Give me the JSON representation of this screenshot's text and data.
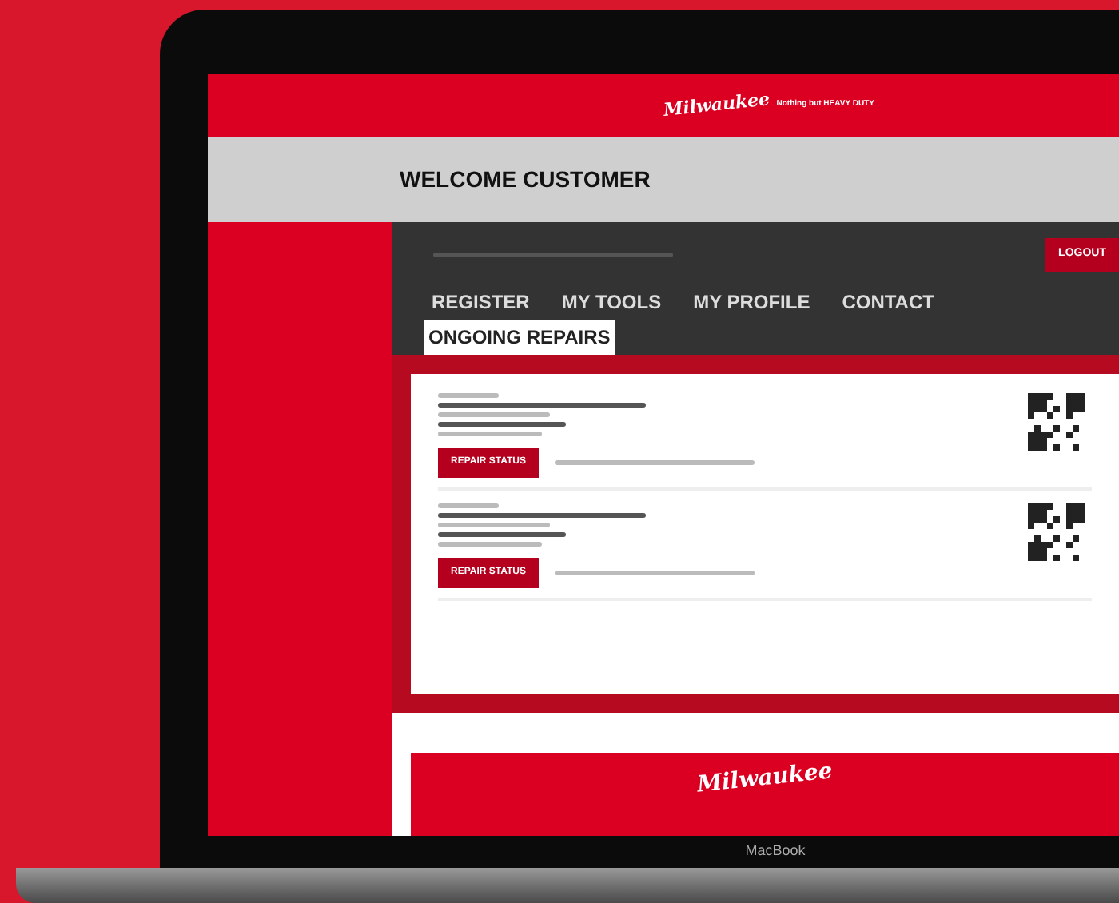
{
  "header": {
    "logo": "Milwaukee",
    "tagline": "Nothing but HEAVY DUTY"
  },
  "welcome": "WELCOME CUSTOMER",
  "account_bar": {
    "logout": "LOGOUT"
  },
  "nav": [
    {
      "label": "REGISTER",
      "selected": false
    },
    {
      "label": "MY TOOLS",
      "selected": false
    },
    {
      "label": "MY PROFILE",
      "selected": false
    },
    {
      "label": "CONTACT",
      "selected": false
    },
    {
      "label": "ONGOING REPAIRS",
      "selected": true
    }
  ],
  "repairs": [
    {
      "button": "REPAIR STATUS"
    },
    {
      "button": "REPAIR STATUS"
    }
  ],
  "footer": {
    "logo": "Milwaukee"
  },
  "laptop": {
    "label": "MacBook"
  }
}
